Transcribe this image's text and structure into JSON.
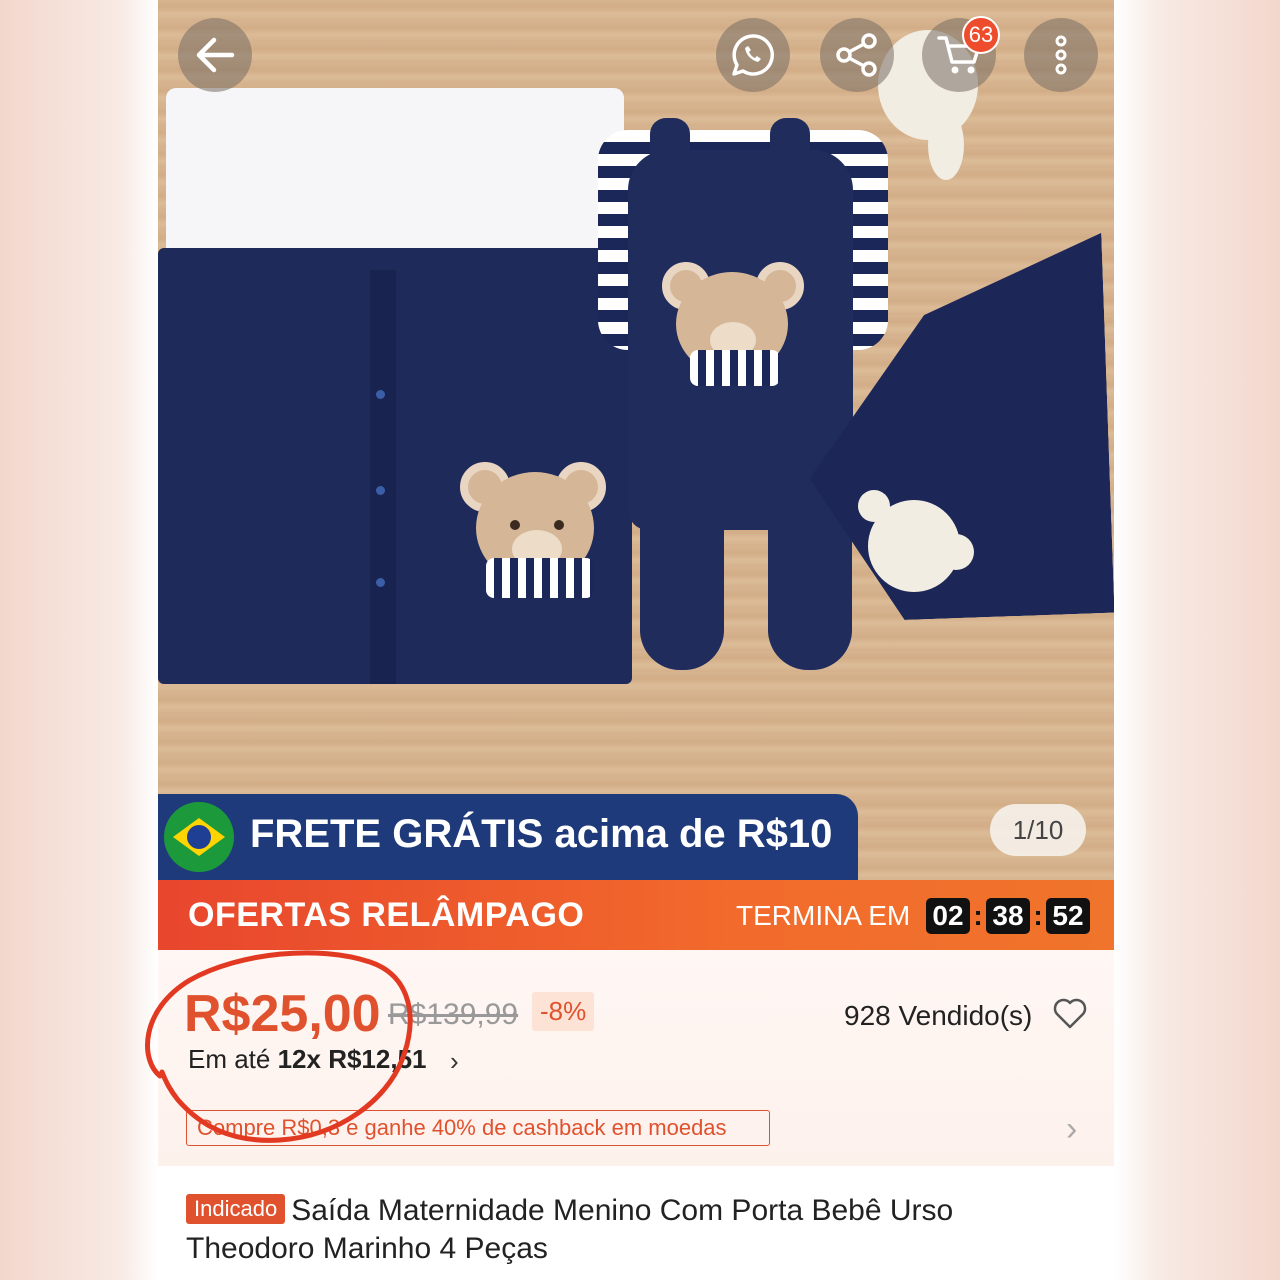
{
  "header": {
    "badge_count": "63"
  },
  "gallery": {
    "counter": "1/10"
  },
  "shipping_banner": {
    "bold": "FRETE GRÁTIS",
    "rest": " acima de R$10"
  },
  "flash": {
    "title": "OFERTAS RELÂMPAGO",
    "ends_label": "TERMINA EM",
    "hours": "02",
    "minutes": "38",
    "seconds": "52"
  },
  "price": {
    "current": "R$25,00",
    "original": "R$139,99",
    "discount": "-8%",
    "sold": "928 Vendido(s)",
    "installments_prefix": "Em até ",
    "installments_value": "12x R$12,51",
    "cashback": "Compre R$0,3 e ganhe 40% de cashback em moedas"
  },
  "product": {
    "tag": "Indicado",
    "title": "Saída Maternidade Menino Com Porta Bebê Urso Theodoro Marinho 4 Peças"
  },
  "colors": {
    "accent": "#ee4d2d",
    "price": "#e0522e",
    "navy": "#1f2c5c"
  },
  "icons": [
    "back-arrow-icon",
    "whatsapp-icon",
    "share-icon",
    "cart-icon",
    "more-vertical-icon",
    "heart-icon",
    "chevron-right-icon",
    "brazil-flag-icon"
  ]
}
